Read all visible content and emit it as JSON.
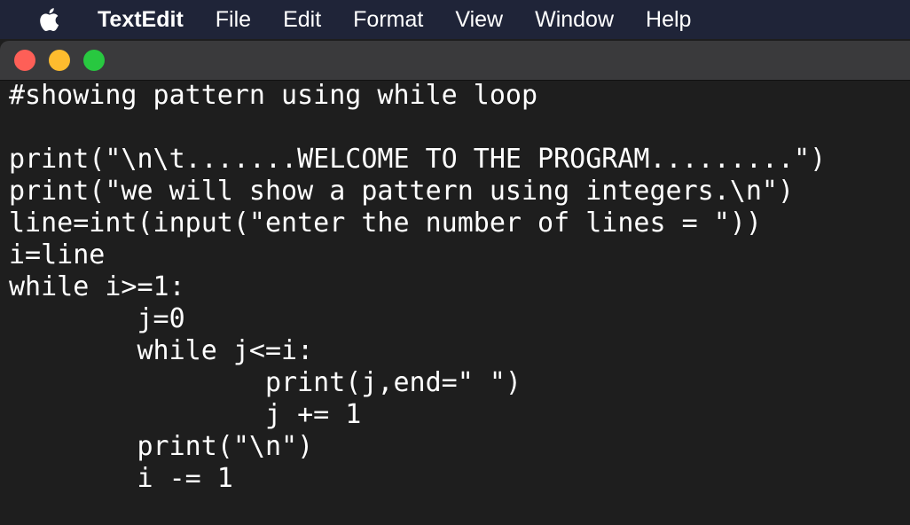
{
  "menubar": {
    "apple_icon": "apple-logo",
    "app_name": "TextEdit",
    "items": [
      "File",
      "Edit",
      "Format",
      "View",
      "Window",
      "Help"
    ]
  },
  "window": {
    "traffic_lights": {
      "close_color": "#fe5f57",
      "minimize_color": "#febc2e",
      "zoom_color": "#28c840"
    }
  },
  "document": {
    "lines": [
      "#showing pattern using while loop",
      "",
      "print(\"\\n\\t.......WELCOME TO THE PROGRAM.........\")",
      "print(\"we will show a pattern using integers.\\n\")",
      "line=int(input(\"enter the number of lines = \"))",
      "i=line",
      "while i>=1:",
      "        j=0",
      "        while j<=i:",
      "                print(j,end=\" \")",
      "                j += 1",
      "        print(\"\\n\")",
      "        i -= 1"
    ]
  }
}
